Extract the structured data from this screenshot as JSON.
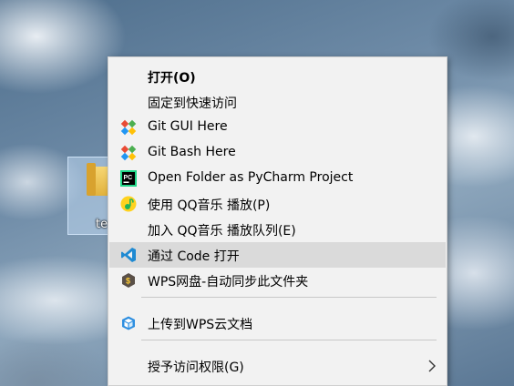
{
  "desktop": {
    "icon_label": "te"
  },
  "menu": {
    "items": [
      {
        "label": "打开(O)",
        "icon": "none",
        "bold": true
      },
      {
        "label": "固定到快速访问",
        "icon": "none"
      },
      {
        "label": "Git GUI Here",
        "icon": "git-gui-icon"
      },
      {
        "label": "Git Bash Here",
        "icon": "git-bash-icon"
      },
      {
        "label": "Open Folder as PyCharm Project",
        "icon": "pycharm-icon"
      },
      {
        "label": "使用 QQ音乐 播放(P)",
        "icon": "qqmusic-icon"
      },
      {
        "label": "加入 QQ音乐 播放队列(E)",
        "icon": "none"
      },
      {
        "label": "通过 Code 打开",
        "icon": "vscode-icon",
        "highlighted": true
      },
      {
        "label": "WPS网盘-自动同步此文件夹",
        "icon": "wps-sync-icon"
      },
      {
        "label": "上传到WPS云文档",
        "icon": "wps-cloud-icon"
      },
      {
        "label": "授予访问权限(G)",
        "icon": "none",
        "submenu": true
      }
    ]
  },
  "colors": {
    "menu_bg": "#f2f2f2",
    "highlight_bg": "#dadada",
    "separator": "#c8c8c8"
  }
}
